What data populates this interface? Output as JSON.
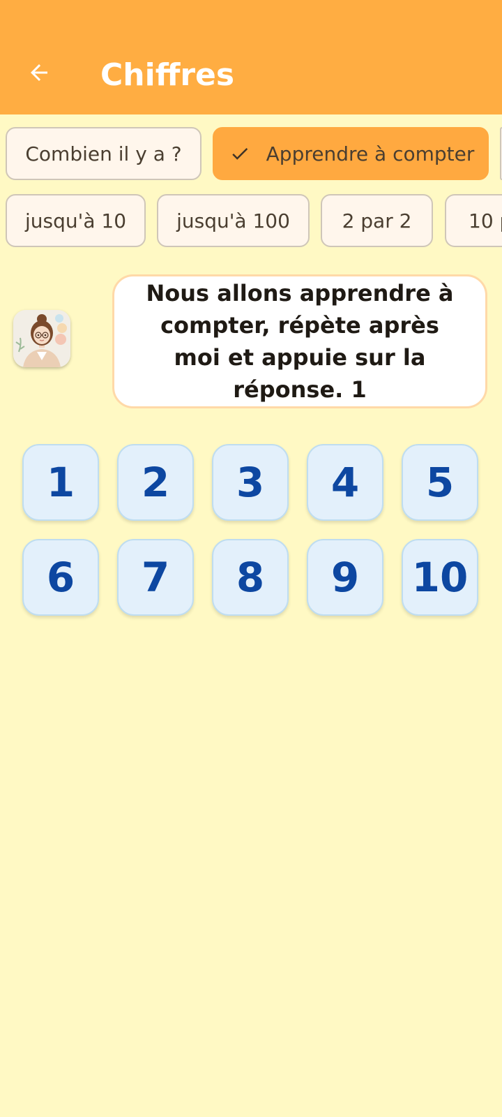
{
  "app_bar": {
    "title": "Chiffres",
    "back_icon": "arrow-back-icon",
    "color": "#FFAD42"
  },
  "modes": [
    {
      "label": "Combien il y a ?",
      "selected": false
    },
    {
      "label": "Apprendre à compter",
      "selected": true
    }
  ],
  "ranges": [
    {
      "label": "jusqu'à 10"
    },
    {
      "label": "jusqu'à 100"
    },
    {
      "label": "2 par 2"
    },
    {
      "label": "10 p"
    }
  ],
  "teacher": {
    "avatar": "teacher-avatar",
    "message": "Nous allons apprendre à compter, répète après moi et appuie sur la réponse. 1"
  },
  "numbers": [
    "1",
    "2",
    "3",
    "4",
    "5",
    "6",
    "7",
    "8",
    "9",
    "10"
  ],
  "colors": {
    "background": "#FFF9C4",
    "accent": "#FFA940",
    "number_text": "#0D47A1",
    "number_tile": "#E3F0FB"
  }
}
